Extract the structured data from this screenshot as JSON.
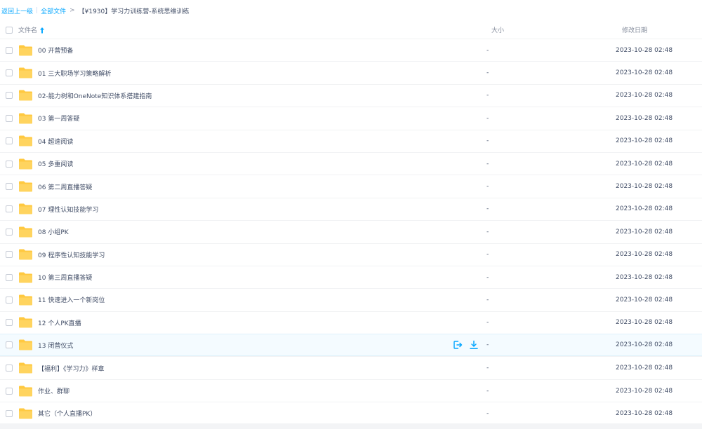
{
  "breadcrumb": {
    "back_label": "返回上一级",
    "separator": "|",
    "all_files_label": "全部文件",
    "arrow": ">",
    "current_folder": "【¥1930】学习力训练营-系统思维训练"
  },
  "columns": {
    "name": "文件名",
    "size": "大小",
    "modified": "修改日期",
    "sort_icon": "arrow-up-icon"
  },
  "colors": {
    "link": "#06a7ff",
    "folder": "#ffd159",
    "text": "#424e67",
    "header_text": "#818999",
    "hover_row": "#f4fbff"
  },
  "row_actions": {
    "share_icon": "share-exit-icon",
    "download_icon": "download-icon"
  },
  "files": [
    {
      "name": "00 开营预备",
      "size": "-",
      "modified": "2023-10-28 02:48"
    },
    {
      "name": "01 三大职场学习策略解析",
      "size": "-",
      "modified": "2023-10-28 02:48"
    },
    {
      "name": "02-能力树和OneNote知识体系搭建指南",
      "size": "-",
      "modified": "2023-10-28 02:48"
    },
    {
      "name": "03 第一周答疑",
      "size": "-",
      "modified": "2023-10-28 02:48"
    },
    {
      "name": "04 超速阅读",
      "size": "-",
      "modified": "2023-10-28 02:48"
    },
    {
      "name": "05 多重阅读",
      "size": "-",
      "modified": "2023-10-28 02:48"
    },
    {
      "name": "06 第二周直播答疑",
      "size": "-",
      "modified": "2023-10-28 02:48"
    },
    {
      "name": "07 理性认知技能学习",
      "size": "-",
      "modified": "2023-10-28 02:48"
    },
    {
      "name": "08 小组PK",
      "size": "-",
      "modified": "2023-10-28 02:48"
    },
    {
      "name": "09 程序性认知技能学习",
      "size": "-",
      "modified": "2023-10-28 02:48"
    },
    {
      "name": "10 第三周直播答疑",
      "size": "-",
      "modified": "2023-10-28 02:48"
    },
    {
      "name": "11 快速进入一个新岗位",
      "size": "-",
      "modified": "2023-10-28 02:48"
    },
    {
      "name": "12 个人PK直播",
      "size": "-",
      "modified": "2023-10-28 02:48"
    },
    {
      "name": "13 闭营仪式",
      "size": "-",
      "modified": "2023-10-28 02:48",
      "hovered": true
    },
    {
      "name": "【福利】《学习力》样章",
      "size": "-",
      "modified": "2023-10-28 02:48"
    },
    {
      "name": "作业、群聊",
      "size": "-",
      "modified": "2023-10-28 02:48"
    },
    {
      "name": "其它（个人直播PK）",
      "size": "-",
      "modified": "2023-10-28 02:48"
    }
  ]
}
